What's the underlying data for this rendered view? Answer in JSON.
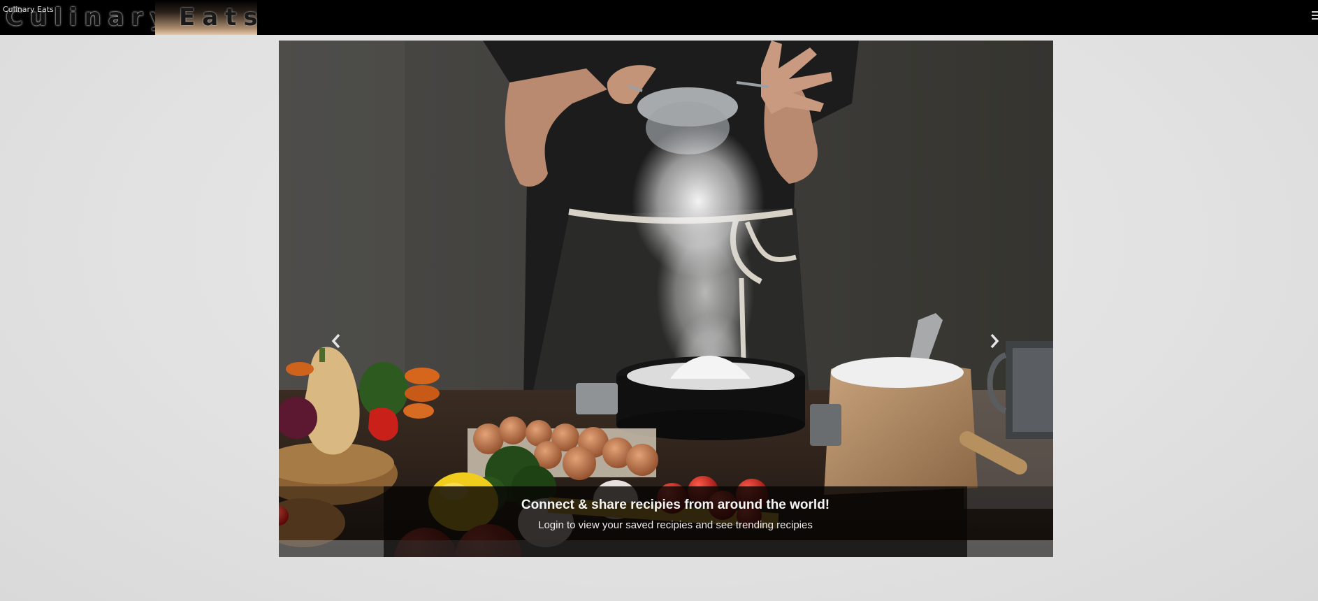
{
  "window": {
    "tab_title": "Culinary Eats"
  },
  "header": {
    "brand_part_1": "Culinary",
    "brand_part_2": "Eats",
    "menu_icon": "hamburger-menu-icon"
  },
  "carousel": {
    "prev_icon": "chevron-left-icon",
    "next_icon": "chevron-right-icon",
    "slide": {
      "image_description": "chef sifting flour over a bowl with vegetables, eggs and flour bag",
      "caption_title": "Connect & share recipies from around the world!",
      "caption_subtitle": "Login to view your saved recipies and see trending recipies"
    }
  },
  "colors": {
    "header_bg": "#000000",
    "page_bg": "#e4e4e4",
    "brand_accent": "#e7c8a8"
  }
}
